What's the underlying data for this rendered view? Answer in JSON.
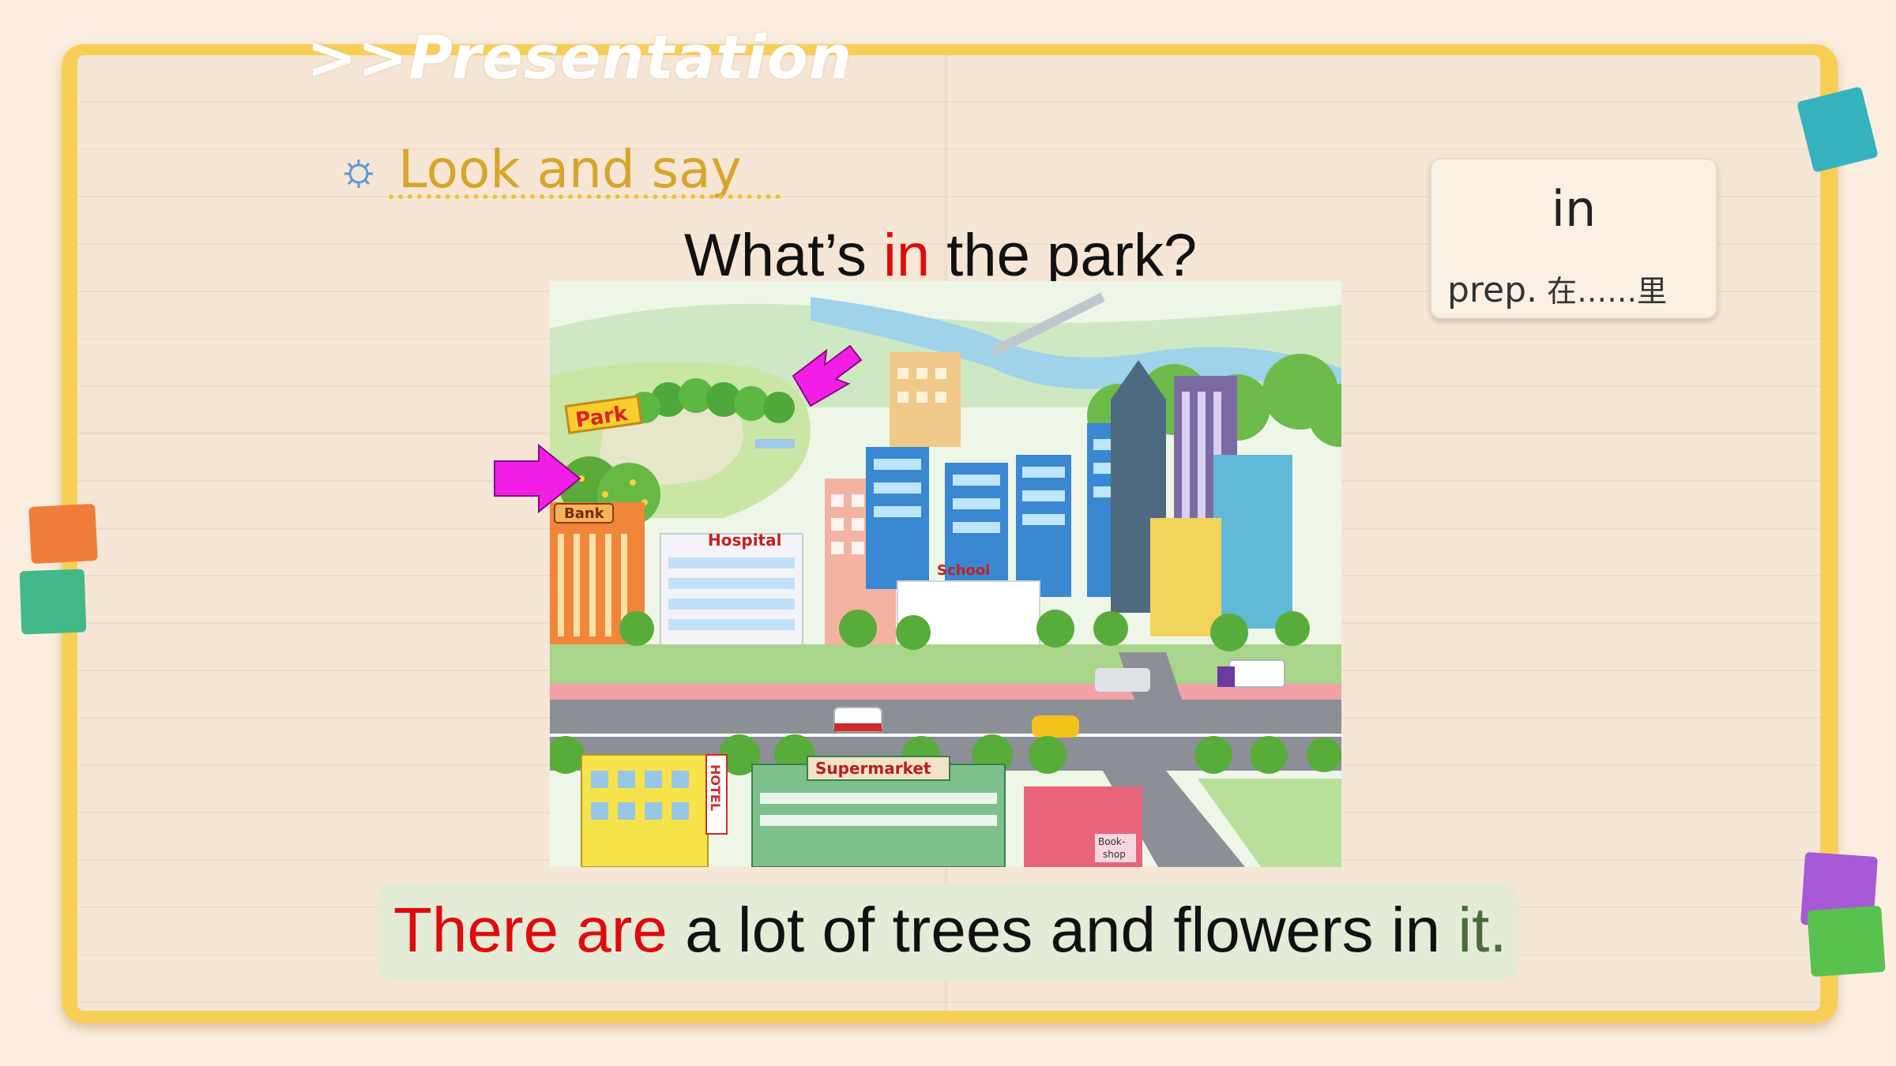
{
  "header": {
    "section_title": ">>Presentation"
  },
  "subtitle": {
    "icon": "gear-icon",
    "text": "Look and say"
  },
  "question": {
    "before": "What’s ",
    "highlight": "in",
    "after": " the park?"
  },
  "vocab_card": {
    "word": "in",
    "pos": "prep.",
    "meaning": " 在……里"
  },
  "picture": {
    "labels": {
      "park": "Park",
      "bank": "Bank",
      "hospital": "Hospital",
      "school": "School",
      "supermarket": "Supermarket",
      "hotel": "HOTEL",
      "bookshop_line1": "Book-",
      "bookshop_line2": "shop"
    }
  },
  "answer": {
    "part1": "There are",
    "part2": " a lot of trees and flowers in ",
    "part3": "it."
  },
  "colors": {
    "accent_yellow": "#f7cf55",
    "highlight_red": "#e00b0b",
    "arrow_magenta": "#f21ee6"
  }
}
